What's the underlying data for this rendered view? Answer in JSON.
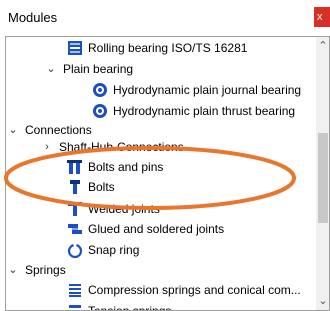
{
  "header": {
    "title": "Modules",
    "close_label": "x"
  },
  "tree": [
    {
      "id": "rolling-bearing",
      "label": "Rolling bearing ISO/TS 16281",
      "icon": "rolling-bearing-icon"
    },
    {
      "id": "plain-bearing",
      "label": "Plain bearing",
      "toggle": "expanded"
    },
    {
      "id": "hydro-journal",
      "label": "Hydrodynamic plain journal bearing",
      "icon": "gear-icon"
    },
    {
      "id": "hydro-thrust",
      "label": "Hydrodynamic plain thrust bearing",
      "icon": "gear-icon"
    },
    {
      "id": "connections",
      "label": "Connections",
      "toggle": "expanded"
    },
    {
      "id": "shaft-hub",
      "label": "Shaft-Hub-Connections",
      "toggle": "collapsed"
    },
    {
      "id": "bolts-pins",
      "label": "Bolts and pins",
      "icon": "bolts-pins-icon"
    },
    {
      "id": "bolts",
      "label": "Bolts",
      "icon": "bolt-icon"
    },
    {
      "id": "welded",
      "label": "Welded joints",
      "icon": "welded-joint-icon"
    },
    {
      "id": "glued",
      "label": "Glued and soldered joints",
      "icon": "glued-joint-icon"
    },
    {
      "id": "snap-ring",
      "label": "Snap ring",
      "icon": "snap-ring-icon"
    },
    {
      "id": "springs",
      "label": "Springs",
      "toggle": "expanded"
    },
    {
      "id": "compression",
      "label": "Compression springs and conical com...",
      "icon": "compression-spring-icon"
    },
    {
      "id": "tension",
      "label": "Tension springs",
      "icon": "tension-spring-icon"
    }
  ],
  "colors": {
    "annotation": "#e8762c",
    "close_bg": "#d93025",
    "icon_blue": "#1c4fc2"
  }
}
